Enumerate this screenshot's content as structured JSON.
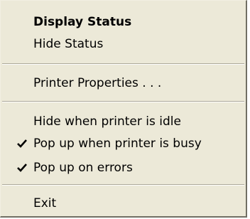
{
  "menu": {
    "items": [
      {
        "label": "Display Status",
        "bold": true
      },
      {
        "label": "Hide Status"
      },
      {
        "label": "Printer Properties . . ."
      },
      {
        "label": "Hide when printer is idle",
        "checked": false
      },
      {
        "label": "Pop up when printer is busy",
        "checked": true,
        "check_icon": "checkmark-icon"
      },
      {
        "label": "Pop up on errors",
        "checked": true,
        "check_icon": "checkmark-icon"
      },
      {
        "label": "Exit"
      }
    ]
  }
}
